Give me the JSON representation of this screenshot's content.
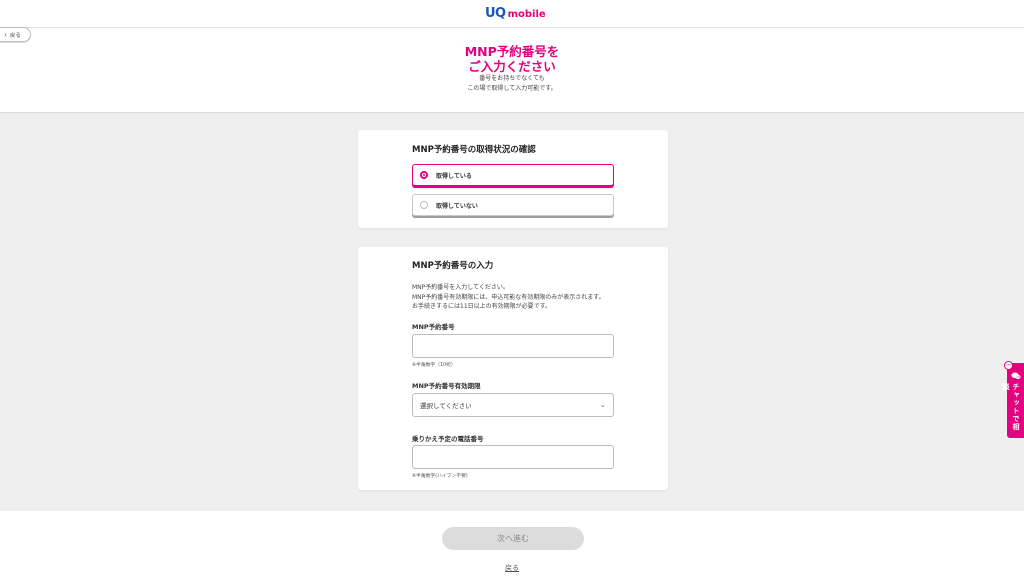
{
  "header": {
    "logo_left": "UQ",
    "logo_right": "mobile",
    "back_label": "戻る"
  },
  "intro": {
    "title_line1": "MNP予約番号を",
    "title_line2": "ご入力ください",
    "sub_line1": "番号をお持ちでなくても",
    "sub_line2": "この場で取得して入力可能です。"
  },
  "status_card": {
    "title": "MNP予約番号の取得状況の確認",
    "options": [
      {
        "label": "取得している",
        "selected": true
      },
      {
        "label": "取得していない",
        "selected": false
      }
    ]
  },
  "input_card": {
    "title": "MNP予約番号の入力",
    "desc_line1": "MNP予約番号を入力してください。",
    "desc_line2": "MNP予約番号有効期限には、申込可能な有効期限のみが表示されます。",
    "desc_line3": "お手続きするには11日以上の有効期限が必要です。",
    "number_label": "MNP予約番号",
    "number_value": "",
    "number_hint": "※半角数字（10桁）",
    "expiry_label": "MNP予約番号有効期限",
    "expiry_selected": "選択してください",
    "phone_label": "乗りかえ予定の電話番号",
    "phone_value": "",
    "phone_hint": "※半角数字(ハイフン不要)"
  },
  "chat": {
    "label": "チャットで相談",
    "icon": "chat-bubble-icon"
  },
  "footer": {
    "next_label": "次へ進む",
    "back_label": "戻る"
  },
  "colors": {
    "accent": "#e4007f",
    "brand_blue": "#1a56b8",
    "band": "#efefef"
  }
}
